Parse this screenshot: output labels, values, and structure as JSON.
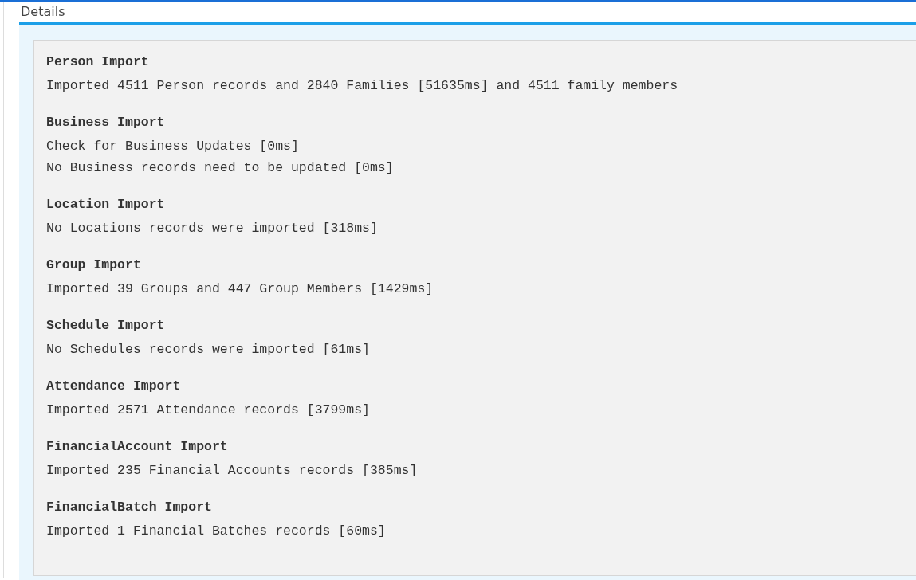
{
  "section_title": "Details",
  "log": [
    {
      "title": "Person Import",
      "lines": [
        "Imported 4511 Person records and 2840 Families [51635ms] and 4511 family members"
      ]
    },
    {
      "title": "Business Import",
      "lines": [
        "Check for Business Updates [0ms]",
        "No Business records need to be updated [0ms]"
      ]
    },
    {
      "title": "Location Import",
      "lines": [
        "No Locations records were imported [318ms]"
      ]
    },
    {
      "title": "Group Import",
      "lines": [
        "Imported 39 Groups and 447 Group Members [1429ms]"
      ]
    },
    {
      "title": "Schedule Import",
      "lines": [
        "No Schedules records were imported [61ms]"
      ]
    },
    {
      "title": "Attendance Import",
      "lines": [
        "Imported 2571 Attendance records [3799ms]"
      ]
    },
    {
      "title": "FinancialAccount Import",
      "lines": [
        "Imported 235 Financial Accounts records [385ms]"
      ]
    },
    {
      "title": "FinancialBatch Import",
      "lines": [
        "Imported 1 Financial Batches records [60ms]"
      ]
    }
  ]
}
